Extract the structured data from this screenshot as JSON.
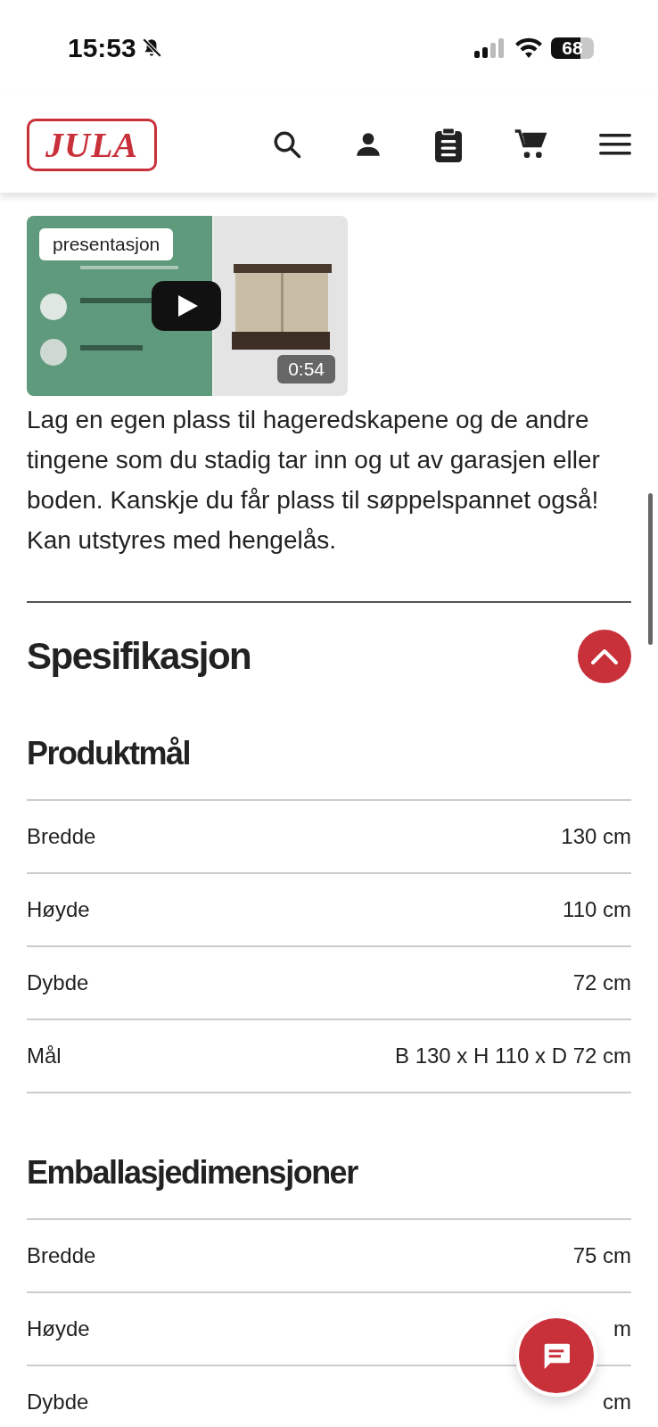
{
  "status_bar": {
    "time": "15:53",
    "silenced": true,
    "battery": "68"
  },
  "header": {
    "logo": "JULA"
  },
  "video": {
    "kind": "picture",
    "badge": "presentasjon",
    "duration": "0:54"
  },
  "description": "Lag en egen plass til hageredskapene og de andre tingene som du stadig tar inn og ut av garasjen eller boden. Kanskje du får plass til søppelspannet også! Kan utstyres med hengelås.",
  "specification": {
    "title": "Spesifikasjon",
    "expanded": true,
    "groups": [
      {
        "title": "Produktmål",
        "rows": [
          {
            "label": "Bredde",
            "value": "130 cm"
          },
          {
            "label": "Høyde",
            "value": "110 cm"
          },
          {
            "label": "Dybde",
            "value": "72 cm"
          },
          {
            "label": "Mål",
            "value": "B 130 x H 110 x D 72 cm"
          }
        ]
      },
      {
        "title": "Emballasjedimensjoner",
        "rows": [
          {
            "label": "Bredde",
            "value": "75 cm"
          },
          {
            "label": "Høyde",
            "value": "m"
          },
          {
            "label": "Dybde",
            "value": "cm"
          }
        ]
      }
    ]
  }
}
